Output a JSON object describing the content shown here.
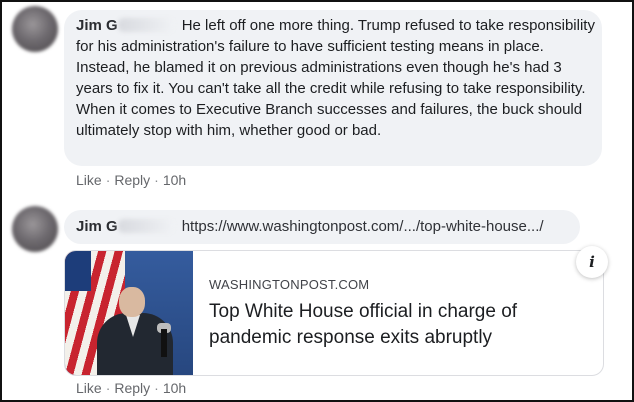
{
  "comments": [
    {
      "author": "Jim G",
      "text": "He left off one more thing. Trump refused to take responsibility for his administration's failure to have sufficient testing means in place. Instead, he blamed it on previous administrations even though he's had 3 years to fix it. You can't take all the credit while refusing to take responsibility. When it comes to Executive Branch successes and failures, the buck should ultimately stop with him, whether good or bad.",
      "actions": {
        "like": "Like",
        "reply": "Reply",
        "time": "10h"
      }
    },
    {
      "author": "Jim G",
      "link_text": "https://www.washingtonpost.com/.../top-white-house.../",
      "preview": {
        "domain": "WASHINGTONPOST.COM",
        "headline": "Top White House official in charge of pandemic response exits abruptly",
        "info_icon": "i"
      },
      "actions": {
        "like": "Like",
        "reply": "Reply",
        "time": "10h"
      }
    }
  ],
  "separator": "·"
}
